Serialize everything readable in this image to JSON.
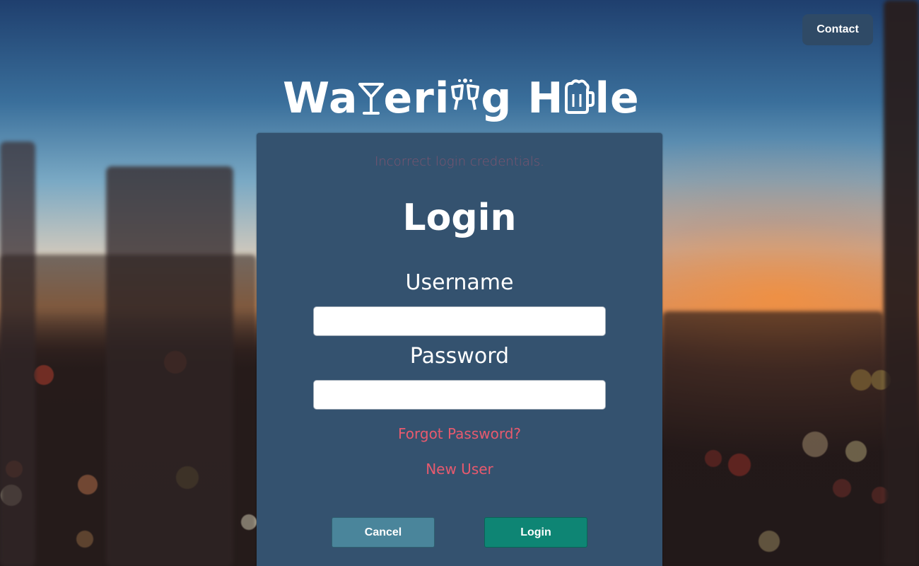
{
  "header": {
    "contact_label": "Contact"
  },
  "logo": {
    "part1": "Wa",
    "part2": "eri",
    "part3": "g H",
    "part4": "le",
    "icons": [
      "cocktail-glass-icon",
      "cheers-glasses-icon",
      "beer-mug-icon"
    ]
  },
  "login": {
    "error_message": "Incorrect login credentials.",
    "title": "Login",
    "username_label": "Username",
    "password_label": "Password",
    "username_value": "",
    "password_value": "",
    "forgot_password_link": "Forgot Password?",
    "new_user_link": "New User",
    "cancel_label": "Cancel",
    "login_label": "Login"
  },
  "colors": {
    "panel": "#34526f",
    "link": "#e85a6e",
    "error": "#7d5570",
    "cancel_button": "#4a859b",
    "login_button": "#0e8574",
    "contact_button": "#2f4a66"
  }
}
